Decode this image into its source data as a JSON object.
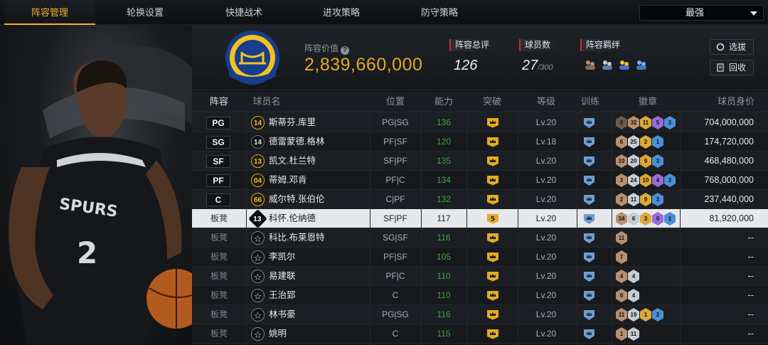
{
  "tabs": [
    {
      "label": "阵容管理",
      "active": true
    },
    {
      "label": "轮换设置",
      "active": false
    },
    {
      "label": "快捷战术",
      "active": false
    },
    {
      "label": "进攻策略",
      "active": false
    },
    {
      "label": "防守策略",
      "active": false
    }
  ],
  "filter_dropdown": {
    "selected": "最强"
  },
  "header": {
    "value_label": "阵容价值",
    "value": "2,839,660,000",
    "rating_label": "阵容总评",
    "rating": "126",
    "count_label": "球员数",
    "count": "27",
    "count_max": "/300",
    "bonds_label": "阵容羁绊",
    "pick_button": "选拔",
    "recycle_button": "回收"
  },
  "columns": [
    "阵容",
    "球员名",
    "位置",
    "能力",
    "突破",
    "等级",
    "训练",
    "徽章",
    "球员身价"
  ],
  "rows": [
    {
      "slot": "PG",
      "starter": true,
      "num": "14",
      "num_style": "gold",
      "name": "斯蒂芬.库里",
      "pos": "PG|SG",
      "ability": "136",
      "breakthrough": "crown",
      "level": "Lv.20",
      "badges": [
        {
          "v": "0",
          "c": "#6b5a48"
        },
        {
          "v": "32",
          "c": "#b98f6f"
        },
        {
          "v": "11",
          "c": "#d9a93a"
        },
        {
          "v": "5",
          "c": "#9a6ad8"
        },
        {
          "v": "3",
          "c": "#4b8fd6"
        }
      ],
      "worth": "704,000,000"
    },
    {
      "slot": "SG",
      "starter": true,
      "num": "14",
      "num_style": "dark",
      "name": "德雷蒙德.格林",
      "pos": "PF|SF",
      "ability": "120",
      "breakthrough": "crown",
      "level": "Lv.18",
      "badges": [
        {
          "v": "6",
          "c": "#b98f6f"
        },
        {
          "v": "25",
          "c": "#c7ccd2"
        },
        {
          "v": "2",
          "c": "#d9a93a"
        },
        {
          "v": "1",
          "c": "#4b8fd6"
        }
      ],
      "worth": "174,720,000"
    },
    {
      "slot": "SF",
      "starter": true,
      "num": "13",
      "num_style": "gold",
      "name": "凯文.杜兰特",
      "pos": "SF|PF",
      "ability": "135",
      "breakthrough": "crown",
      "level": "Lv.20",
      "badges": [
        {
          "v": "10",
          "c": "#b98f6f"
        },
        {
          "v": "20",
          "c": "#c7ccd2"
        },
        {
          "v": "9",
          "c": "#d9a93a"
        },
        {
          "v": "3",
          "c": "#4b8fd6"
        }
      ],
      "worth": "468,480,000"
    },
    {
      "slot": "PF",
      "starter": true,
      "num": "04",
      "num_style": "gold",
      "name": "蒂姆.邓肯",
      "pos": "PF|C",
      "ability": "134",
      "breakthrough": "crown",
      "level": "Lv.20",
      "badges": [
        {
          "v": "3",
          "c": "#b98f6f"
        },
        {
          "v": "24",
          "c": "#c7ccd2"
        },
        {
          "v": "10",
          "c": "#d9a93a"
        },
        {
          "v": "4",
          "c": "#9a6ad8"
        },
        {
          "v": "3",
          "c": "#4b8fd6"
        }
      ],
      "worth": "768,000,000"
    },
    {
      "slot": "C",
      "starter": true,
      "num": "66",
      "num_style": "gold",
      "name": "威尔特.张伯伦",
      "pos": "C|PF",
      "ability": "132",
      "breakthrough": "crown",
      "level": "Lv.20",
      "badges": [
        {
          "v": "2",
          "c": "#b98f6f"
        },
        {
          "v": "11",
          "c": "#c7ccd2"
        },
        {
          "v": "9",
          "c": "#d9a93a"
        },
        {
          "v": "3",
          "c": "#4b8fd6"
        }
      ],
      "worth": "237,440,000"
    },
    {
      "slot": "板凳",
      "starter": false,
      "selected": true,
      "num": "13",
      "num_style": "black",
      "name": "科怀.伦纳德",
      "pos": "SF|PF",
      "ability": "117",
      "breakthrough": "5",
      "level": "Lv.20",
      "badges": [
        {
          "v": "34",
          "c": "#b98f6f"
        },
        {
          "v": "6",
          "c": "#c7ccd2"
        },
        {
          "v": "3",
          "c": "#d9a93a"
        },
        {
          "v": "0",
          "c": "#9a6ad8"
        },
        {
          "v": "1",
          "c": "#4b8fd6"
        }
      ],
      "worth": "81,920,000"
    },
    {
      "slot": "板凳",
      "starter": false,
      "num": "",
      "num_style": "star",
      "name": "科比.布莱恩特",
      "pos": "SG|SF",
      "ability": "116",
      "breakthrough": "crown",
      "level": "Lv.20",
      "badges": [
        {
          "v": "11",
          "c": "#b98f6f"
        }
      ],
      "worth": "--"
    },
    {
      "slot": "板凳",
      "starter": false,
      "num": "",
      "num_style": "star",
      "name": "李凯尔",
      "pos": "PF|SF",
      "ability": "105",
      "breakthrough": "crown",
      "level": "Lv.20",
      "badges": [
        {
          "v": "7",
          "c": "#b98f6f"
        }
      ],
      "worth": "--"
    },
    {
      "slot": "板凳",
      "starter": false,
      "num": "",
      "num_style": "star",
      "name": "易建联",
      "pos": "PF|C",
      "ability": "110",
      "breakthrough": "crown",
      "level": "Lv.20",
      "badges": [
        {
          "v": "4",
          "c": "#b98f6f"
        },
        {
          "v": "4",
          "c": "#c7ccd2"
        }
      ],
      "worth": "--"
    },
    {
      "slot": "板凳",
      "starter": false,
      "num": "",
      "num_style": "star",
      "name": "王治郅",
      "pos": "C",
      "ability": "110",
      "breakthrough": "crown",
      "level": "Lv.20",
      "badges": [
        {
          "v": "6",
          "c": "#b98f6f"
        },
        {
          "v": "4",
          "c": "#c7ccd2"
        }
      ],
      "worth": "--"
    },
    {
      "slot": "板凳",
      "starter": false,
      "num": "",
      "num_style": "star",
      "name": "林书豪",
      "pos": "PG|SG",
      "ability": "116",
      "breakthrough": "crown",
      "level": "Lv.20",
      "badges": [
        {
          "v": "11",
          "c": "#b98f6f"
        },
        {
          "v": "19",
          "c": "#c7ccd2"
        },
        {
          "v": "1",
          "c": "#d9a93a"
        },
        {
          "v": "2",
          "c": "#4b8fd6"
        }
      ],
      "worth": "--"
    },
    {
      "slot": "板凳",
      "starter": false,
      "num": "",
      "num_style": "star",
      "name": "姚明",
      "pos": "C",
      "ability": "115",
      "breakthrough": "crown",
      "level": "Lv.20",
      "badges": [
        {
          "v": "1",
          "c": "#b98f6f"
        },
        {
          "v": "11",
          "c": "#c7ccd2"
        }
      ],
      "worth": "--"
    }
  ],
  "colors": {
    "accent": "#f1b42a",
    "value_gold": "#e3aa24",
    "ability_green": "#3ea63a",
    "label_red": "#d02a2a"
  }
}
